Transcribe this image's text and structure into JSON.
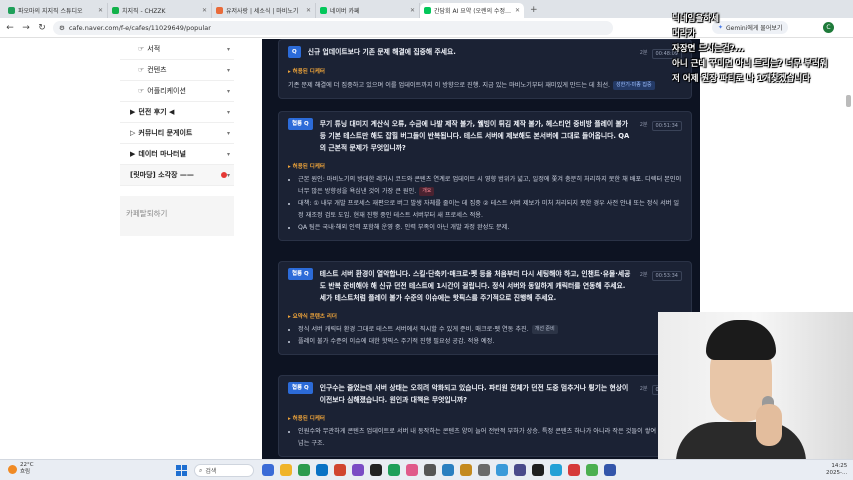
{
  "browser": {
    "tabs": [
      {
        "label": "파오마의 지지직 스튜디오",
        "color": "#1fa05a",
        "active": false
      },
      {
        "label": "치지직 - CHZZK",
        "color": "#12b24a",
        "active": false
      },
      {
        "label": "유저사랑 | 세소식 | 마비노기",
        "color": "#e96b3a",
        "active": false
      },
      {
        "label": "네이버 카페",
        "color": "#03c75a",
        "active": false
      },
      {
        "label": "간담회 AI 요약 (오렌의 수정 ...",
        "color": "#03c75a",
        "active": true
      }
    ],
    "new_tab": "+",
    "url": "cafe.naver.com/f-e/cafes/11029649/popular",
    "gemini_label": "Gemini에게 물어보기",
    "profile_initial": "C"
  },
  "sidebar": {
    "items": [
      {
        "label": "서적",
        "prefix": "☞",
        "kind": "sub"
      },
      {
        "label": "컨텐츠",
        "prefix": "☞",
        "kind": "sub"
      },
      {
        "label": "어플리케이션",
        "prefix": "☞",
        "kind": "sub"
      },
      {
        "label": "던전 후기 ◀",
        "prefix": "▶",
        "kind": "top"
      },
      {
        "label": "커뮤니티 문게이트",
        "prefix": "▷",
        "kind": "top"
      },
      {
        "label": "데이터 마나터널",
        "prefix": "▶",
        "kind": "top"
      },
      {
        "label": "[릿마당] 소각장 ——",
        "prefix": "",
        "kind": "tag"
      }
    ],
    "footer": "카페탈퇴하기"
  },
  "qa": [
    {
      "badge": "Q",
      "question": "신규 업데이트보다 기존 문제 해결에 집중해 주세요.",
      "meta": "2분",
      "time": "00:48:09",
      "section": "▸ 허용된 디케터",
      "answer": "기존 문제 해결에 더 집중하고 있으며 이를 업데이트까지 이 방향으로 진행. 지금 있는 마비노기부터 재미있게 만드는 데 최선.",
      "chip": "성한기-미종 집중"
    },
    {
      "badge": "협룡 Q",
      "question": "무기 튜닝 대미지 계산식 오류, 수금에 나발 제작 불가, 웰빙이 튀김 제작 불가, 헤스티언 중비방 플레이 불가 등 기본 테스트만 해도 잡힐 버그들이 반복됩니다. 테스트 서버에 제보해도 본서버에 그대로 들어옵니다. QA의 근본적 문제가 무엇입니까?",
      "meta": "2분",
      "time": "00:51:34",
      "section": "▸ 허용된 디케터",
      "bullets": [
        "근본 원인: 마비노기의 방대한 레거시 코드와 콘텐츠 연계로 업데이트 시 영향 범위가 넓고, 일정에 쫓겨 충분히 처리하지 못한 채 배포. 디렉터 본인이 너무 많은 방향성을 욕심낸 것이 가장 큰 원인.",
        "대책: ① 내부 개발 프로세스 재편으로 버그 발생 자체를 줄이는 데 집중 ② 테스트 서버 제보가 미처 처리되지 못한 경우 사전 안내 또는 정식 서버 일정 재조정 검토 도입. 현재 진행 중인 테스트 서버부터 새 프로세스 적용.",
        "QA 팀은 국내·해외 인력 포함해 운영 중. 인력 부족이 아닌 개발 과정 완성도 문제."
      ],
      "chip": "개요"
    },
    {
      "badge": "협룡 Q",
      "question": "테스트 서버 환경이 열악합니다. 스킬·단축키·매크로·펫 등을 처음부터 다시 세팅해야 하고, 인챈트·유물·세공도 반복 준비해야 해 신규 던전 테스트에 1시간이 걸립니다. 정식 서버와 동일하게 캐릭터를 연동해 주세요. 세가 테스트처럼 플레이 불가 수준의 이슈에는 핫픽스를 주기적으로 진행해 주세요.",
      "meta": "2분",
      "time": "00:53:34",
      "section": "▸ 요약식 콘텐츠 리더",
      "bullets": [
        "정식 서버 캐릭터 환경 그대로 테스트 서버에서 직시할 수 있게 준비. 매크로·펫 연동 추진.",
        "플레이 불가 수준의 이슈에 대한 핫픽스 주기적 진행 필요성 공감. 적용 예정."
      ],
      "chip": "개선 준비"
    },
    {
      "badge": "협룡 Q",
      "question": "인구수는 줄었는데 서버 상태는 오히려 악화되고 있습니다. 파티원 전체가 던전 도중 멈추거나 튕기는 현상이 이전보다 심해졌습니다. 원인과 대책은 무엇입니까?",
      "meta": "2분",
      "time": "00:02:18",
      "section": "▸ 허용된 디케터",
      "bullets": [
        "인원수와 무관하게 콘텐츠 업데이트로 서버 내 동작하는 콘텐츠 양이 늘어 전반적 부하가 상승. 특정 콘텐츠 하나가 아니라 작은 것들이 쌓여 임계치를 넘는 구조."
      ]
    }
  ],
  "chat_overlay": [
    "닉네임을하세",
    "머라카",
    "자장면 드시는건?...",
    "아니 근데 꾸미면 아니 트리는? 너무 부러워",
    "저 어제 원장 파티로 나 1개찾겠습니다"
  ],
  "taskbar": {
    "temp": "22°C",
    "weather": "흐림",
    "search_placeholder": "검색",
    "clock_time": "14:25",
    "clock_date": "2025-..."
  }
}
